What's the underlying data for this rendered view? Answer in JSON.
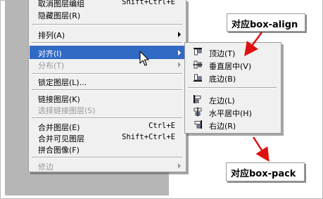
{
  "main_menu": {
    "items": [
      {
        "label": "取消图层编组",
        "shortcut": "Shift+Ctrl+E",
        "disabled": false,
        "submenu": false,
        "highlighted": false
      },
      {
        "label": "隐藏图层(R)",
        "shortcut": "",
        "disabled": false,
        "submenu": false,
        "highlighted": false
      },
      {
        "label": "排列(A)",
        "shortcut": "",
        "disabled": false,
        "submenu": true,
        "highlighted": false
      },
      {
        "label": "对齐(I)",
        "shortcut": "",
        "disabled": false,
        "submenu": true,
        "highlighted": true
      },
      {
        "label": "分布(T)",
        "shortcut": "",
        "disabled": true,
        "submenu": true,
        "highlighted": false
      },
      {
        "label": "锁定图层(L)...",
        "shortcut": "",
        "disabled": false,
        "submenu": false,
        "highlighted": false
      },
      {
        "label": "链接图层(K)",
        "shortcut": "",
        "disabled": false,
        "submenu": false,
        "highlighted": false
      },
      {
        "label": "选择链接图层(S)",
        "shortcut": "",
        "disabled": true,
        "submenu": false,
        "highlighted": false
      },
      {
        "label": "合并图层(E)",
        "shortcut": "Ctrl+E",
        "disabled": false,
        "submenu": false,
        "highlighted": false
      },
      {
        "label": "合并可见图层",
        "shortcut": "Shift+Ctrl+E",
        "disabled": false,
        "submenu": false,
        "highlighted": false
      },
      {
        "label": "拼合图像(F)",
        "shortcut": "",
        "disabled": false,
        "submenu": false,
        "highlighted": false
      },
      {
        "label": "修边",
        "shortcut": "",
        "disabled": true,
        "submenu": true,
        "highlighted": false
      }
    ]
  },
  "align_submenu": {
    "items": [
      {
        "label": "顶边(T)",
        "icon": "align-top-edges-icon"
      },
      {
        "label": "垂直居中(V)",
        "icon": "align-vertical-centers-icon"
      },
      {
        "label": "底边(B)",
        "icon": "align-bottom-edges-icon"
      },
      {
        "label": "左边(L)",
        "icon": "align-left-edges-icon"
      },
      {
        "label": "水平居中(H)",
        "icon": "align-horizontal-centers-icon"
      },
      {
        "label": "右边(R)",
        "icon": "align-right-edges-icon"
      }
    ]
  },
  "annotations": {
    "top": "对应box-align",
    "bottom": "对应box-pack"
  },
  "colors": {
    "highlight": "#316ac5",
    "annotation_text": "#000000",
    "arrow": "#dd1111"
  }
}
